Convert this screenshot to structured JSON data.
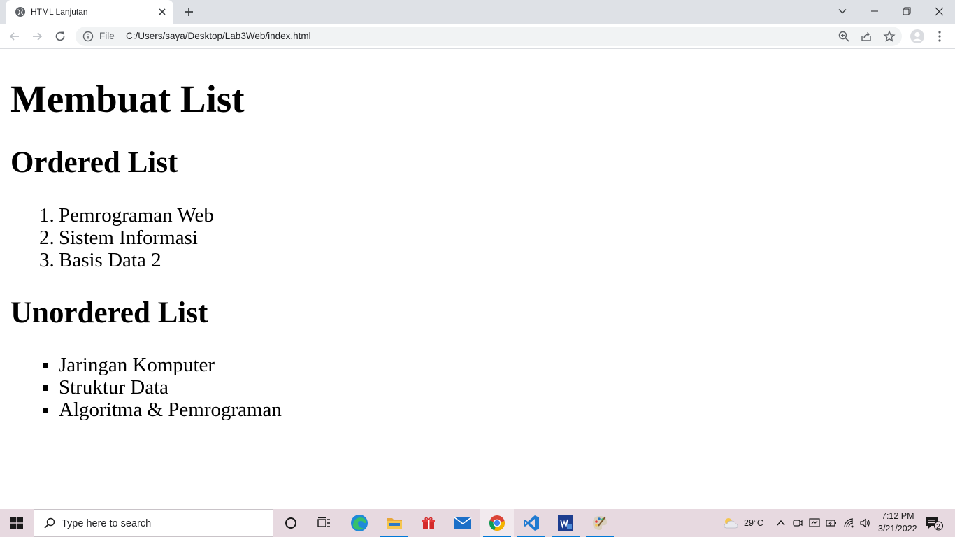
{
  "browser": {
    "tab_title": "HTML Lanjutan",
    "omnibox_prefix": "File",
    "url": "C:/Users/saya/Desktop/Lab3Web/index.html"
  },
  "page": {
    "title": "Membuat List",
    "ordered_heading": "Ordered List",
    "ordered_items": [
      {
        "num": "1.",
        "text": "Pemrograman Web"
      },
      {
        "num": "2.",
        "text": "Sistem Informasi"
      },
      {
        "num": "3.",
        "text": "Basis Data 2"
      }
    ],
    "unordered_heading": "Unordered List",
    "unordered_items": [
      {
        "text": "Jaringan Komputer"
      },
      {
        "text": "Struktur Data"
      },
      {
        "text": "Algoritma & Pemrograman"
      }
    ]
  },
  "taskbar": {
    "search_placeholder": "Type here to search",
    "weather": "29°C",
    "time": "7:12 PM",
    "date": "3/21/2022",
    "notification_count": "2"
  },
  "colors": {
    "tabstrip": "#dee1e6",
    "omnibox": "#f1f3f4",
    "taskbar": "#e7d9e0",
    "accent": "#0078d7"
  }
}
